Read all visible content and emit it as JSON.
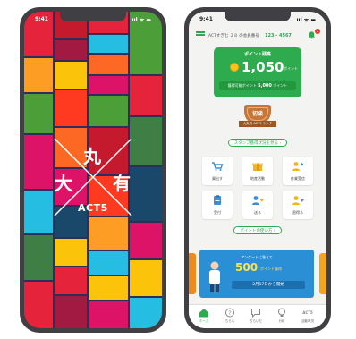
{
  "left_phone": {
    "status_time": "9:41",
    "status_icons": "ııl ᯤ ▬",
    "logo": {
      "char_top": "丸",
      "char_left": "大",
      "char_right": "有",
      "word": "ACT5"
    }
  },
  "right_phone": {
    "status_time": "9:41",
    "status_icons": "ııl ᯤ ▬",
    "header": {
      "text": "ACTすぎむ ２８ の会員番号",
      "member_number": "123 - 4567"
    },
    "badge_count": "2",
    "points": {
      "title": "ポイント残高",
      "value": "1,050",
      "unit": "ポイント",
      "sub_label": "獲得可能ポイント",
      "sub_value": "5,000",
      "sub_unit": "ポイント"
    },
    "rank": {
      "label": "初級",
      "ribbon": "大丸有 ACT5 ランク"
    },
    "stamp_link": "スタンプ獲得状況を見る ›",
    "tiles": [
      {
        "label": "買出す",
        "icon": "cart-icon",
        "color": "#3b8fd8"
      },
      {
        "label": "地産活動",
        "icon": "gift-icon",
        "color": "#f2b41e"
      },
      {
        "label": "作業受信",
        "icon": "person-icon",
        "color": "#f2b41e"
      },
      {
        "label": "受付",
        "icon": "clipboard-icon",
        "color": "#3b8fd8"
      },
      {
        "label": "送る",
        "icon": "user-plus-icon",
        "color": "#3b8fd8"
      },
      {
        "label": "習得る",
        "icon": "user-add-icon",
        "color": "#f2b41e"
      }
    ],
    "points_link": "ポイントの使い方 ›",
    "banner": {
      "line1": "アンケートに答えて",
      "big": "500",
      "big_unit": "ポイント獲得",
      "date": "2月17日から開始"
    },
    "tabs": [
      {
        "label": "ホーム",
        "icon": "home-icon",
        "active": true
      },
      {
        "label": "ちらも",
        "icon": "question-icon",
        "active": false
      },
      {
        "label": "ちらいだ",
        "icon": "chat-icon",
        "active": false
      },
      {
        "label": "分析",
        "icon": "bulb-icon",
        "active": false
      },
      {
        "label": "活動状況",
        "icon": "act5-icon",
        "active": false
      }
    ],
    "tab_act5_mark": "ACT5"
  }
}
